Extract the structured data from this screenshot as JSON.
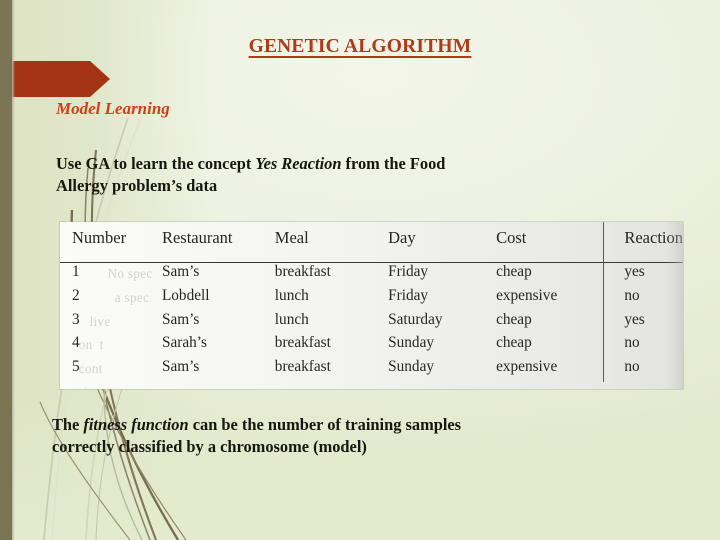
{
  "slide": {
    "title": "GENETIC ALGORITHM",
    "section_heading": "Model Learning",
    "colors": {
      "title": "#b03a18",
      "heading": "#cf3f1a",
      "arrow_banner": "#a53315",
      "olive_bar": "#7a7354",
      "background": "#edf1e0",
      "body_text": "#17160f"
    }
  },
  "paragraph_top": {
    "line1_a": "Use GA to learn the concept ",
    "line1_em": "Yes Reaction",
    "line1_b": " from the Food",
    "line2": "Allergy problem’s data"
  },
  "paragraph_bottom": {
    "line1_a": "The ",
    "line1_em": "fitness function",
    "line1_b": " can be the number of training samples",
    "line2": "correctly classified by a chromosome (model)"
  },
  "table": {
    "headers": [
      "Number",
      "Restaurant",
      "Meal",
      "Day",
      "Cost",
      "Reaction"
    ],
    "rows": [
      [
        "1",
        "Sam’s",
        "breakfast",
        "Friday",
        "cheap",
        "yes"
      ],
      [
        "2",
        "Lobdell",
        "lunch",
        "Friday",
        "expensive",
        "no"
      ],
      [
        "3",
        "Sam’s",
        "lunch",
        "Saturday",
        "cheap",
        "yes"
      ],
      [
        "4",
        "Sarah’s",
        "breakfast",
        "Sunday",
        "cheap",
        "no"
      ],
      [
        "5",
        "Sam’s",
        "breakfast",
        "Sunday",
        "expensive",
        "no"
      ]
    ],
    "ghost_text": "           No spec\n             a spec\n      live\n   on  t\n   cont\n  rti"
  }
}
